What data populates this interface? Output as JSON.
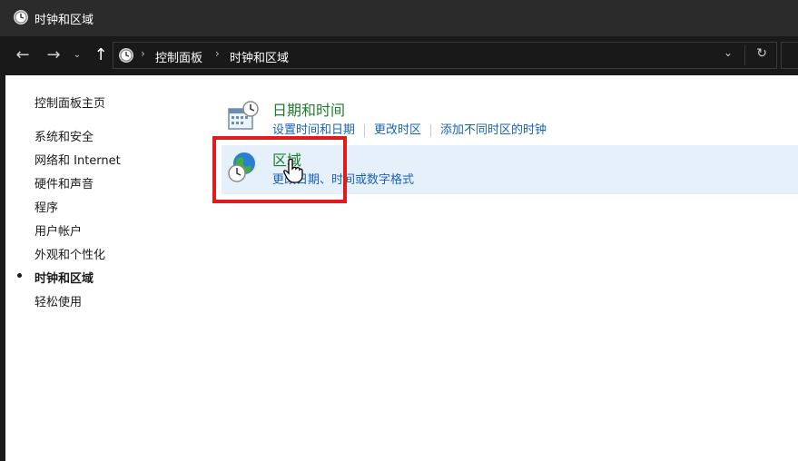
{
  "window": {
    "title": "时钟和区域"
  },
  "address_bar": {
    "breadcrumbs": [
      "控制面板",
      "时钟和区域"
    ]
  },
  "nav": {
    "back_icon": "←",
    "forward_icon": "→",
    "recent_icon": "⌄",
    "up_icon": "↑",
    "dropdown_icon": "⌄",
    "refresh_icon": "↻",
    "crumb_separator": "›"
  },
  "sidebar": {
    "home": "控制面板主页",
    "items": [
      {
        "label": "系统和安全"
      },
      {
        "label": "网络和 Internet"
      },
      {
        "label": "硬件和声音"
      },
      {
        "label": "程序"
      },
      {
        "label": "用户帐户"
      },
      {
        "label": "外观和个性化"
      },
      {
        "label": "时钟和区域",
        "active": true
      },
      {
        "label": "轻松使用"
      }
    ]
  },
  "categories": {
    "datetime": {
      "title": "日期和时间",
      "links": [
        "设置时间和日期",
        "更改时区",
        "添加不同时区的时钟"
      ]
    },
    "region": {
      "title": "区域",
      "link": "更改日期、时间或数字格式"
    }
  },
  "colors": {
    "titlebar": "#2b2b2b",
    "category_title": "#1e7d2e",
    "link": "#1a62b8",
    "hover_bg": "#e6f0fa",
    "highlight": "#e01b1b"
  }
}
